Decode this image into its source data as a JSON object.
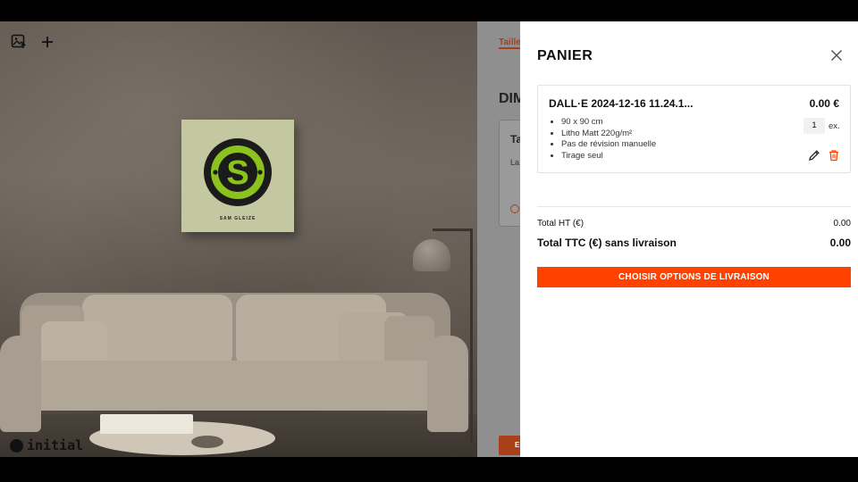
{
  "cart": {
    "title": "PANIER",
    "close_icon": "close-icon",
    "items": [
      {
        "name": "DALL·E 2024-12-16 11.24.1...",
        "price": "0.00 €",
        "specs": [
          "90 x 90 cm",
          "Litho Matt 220g/m²",
          "Pas de révision manuelle",
          "Tirage seul"
        ],
        "quantity": "1",
        "quantity_unit": "ex."
      }
    ],
    "totals": {
      "ht_label": "Total HT (€)",
      "ht_value": "0.00",
      "ttc_label": "Total TTC (€) sans livraison",
      "ttc_value": "0.00"
    },
    "cta_label": "CHOISIR OPTIONS DE LIVRAISON",
    "accent_color": "#ff4200"
  },
  "background_page": {
    "tab_label": "Taille",
    "heading": "DIM",
    "card_title": "Ta",
    "card_text": "La",
    "button_label": "E"
  },
  "preview": {
    "artwork_caption": "SAM GLEIZE",
    "artwork_monogram": "S",
    "brand_name": "initial",
    "toolbar_icons": [
      "image-upload-icon",
      "plus-icon"
    ]
  }
}
